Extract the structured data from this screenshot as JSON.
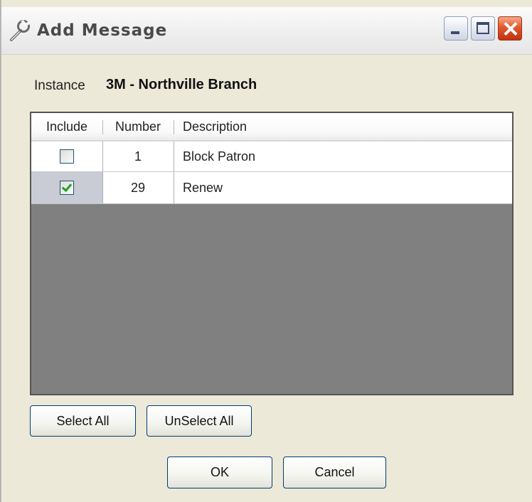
{
  "window": {
    "title": "Add Message"
  },
  "instance": {
    "label": "Instance",
    "value": "3M - Northville Branch"
  },
  "grid": {
    "columns": [
      "Include",
      "Number",
      "Description"
    ],
    "rows": [
      {
        "include": false,
        "number": "1",
        "description": "Block Patron"
      },
      {
        "include": true,
        "number": "29",
        "description": "Renew"
      }
    ]
  },
  "buttons": {
    "select_all": "Select All",
    "unselect_all": "UnSelect All",
    "ok": "OK",
    "cancel": "Cancel"
  },
  "icons": {
    "title": "wrench-icon",
    "minimize": "minimize-icon",
    "maximize": "maximize-icon",
    "close": "close-icon"
  },
  "colors": {
    "grid_empty": "#808080",
    "close_button": "#e2582c",
    "checkmark": "#21a121"
  }
}
